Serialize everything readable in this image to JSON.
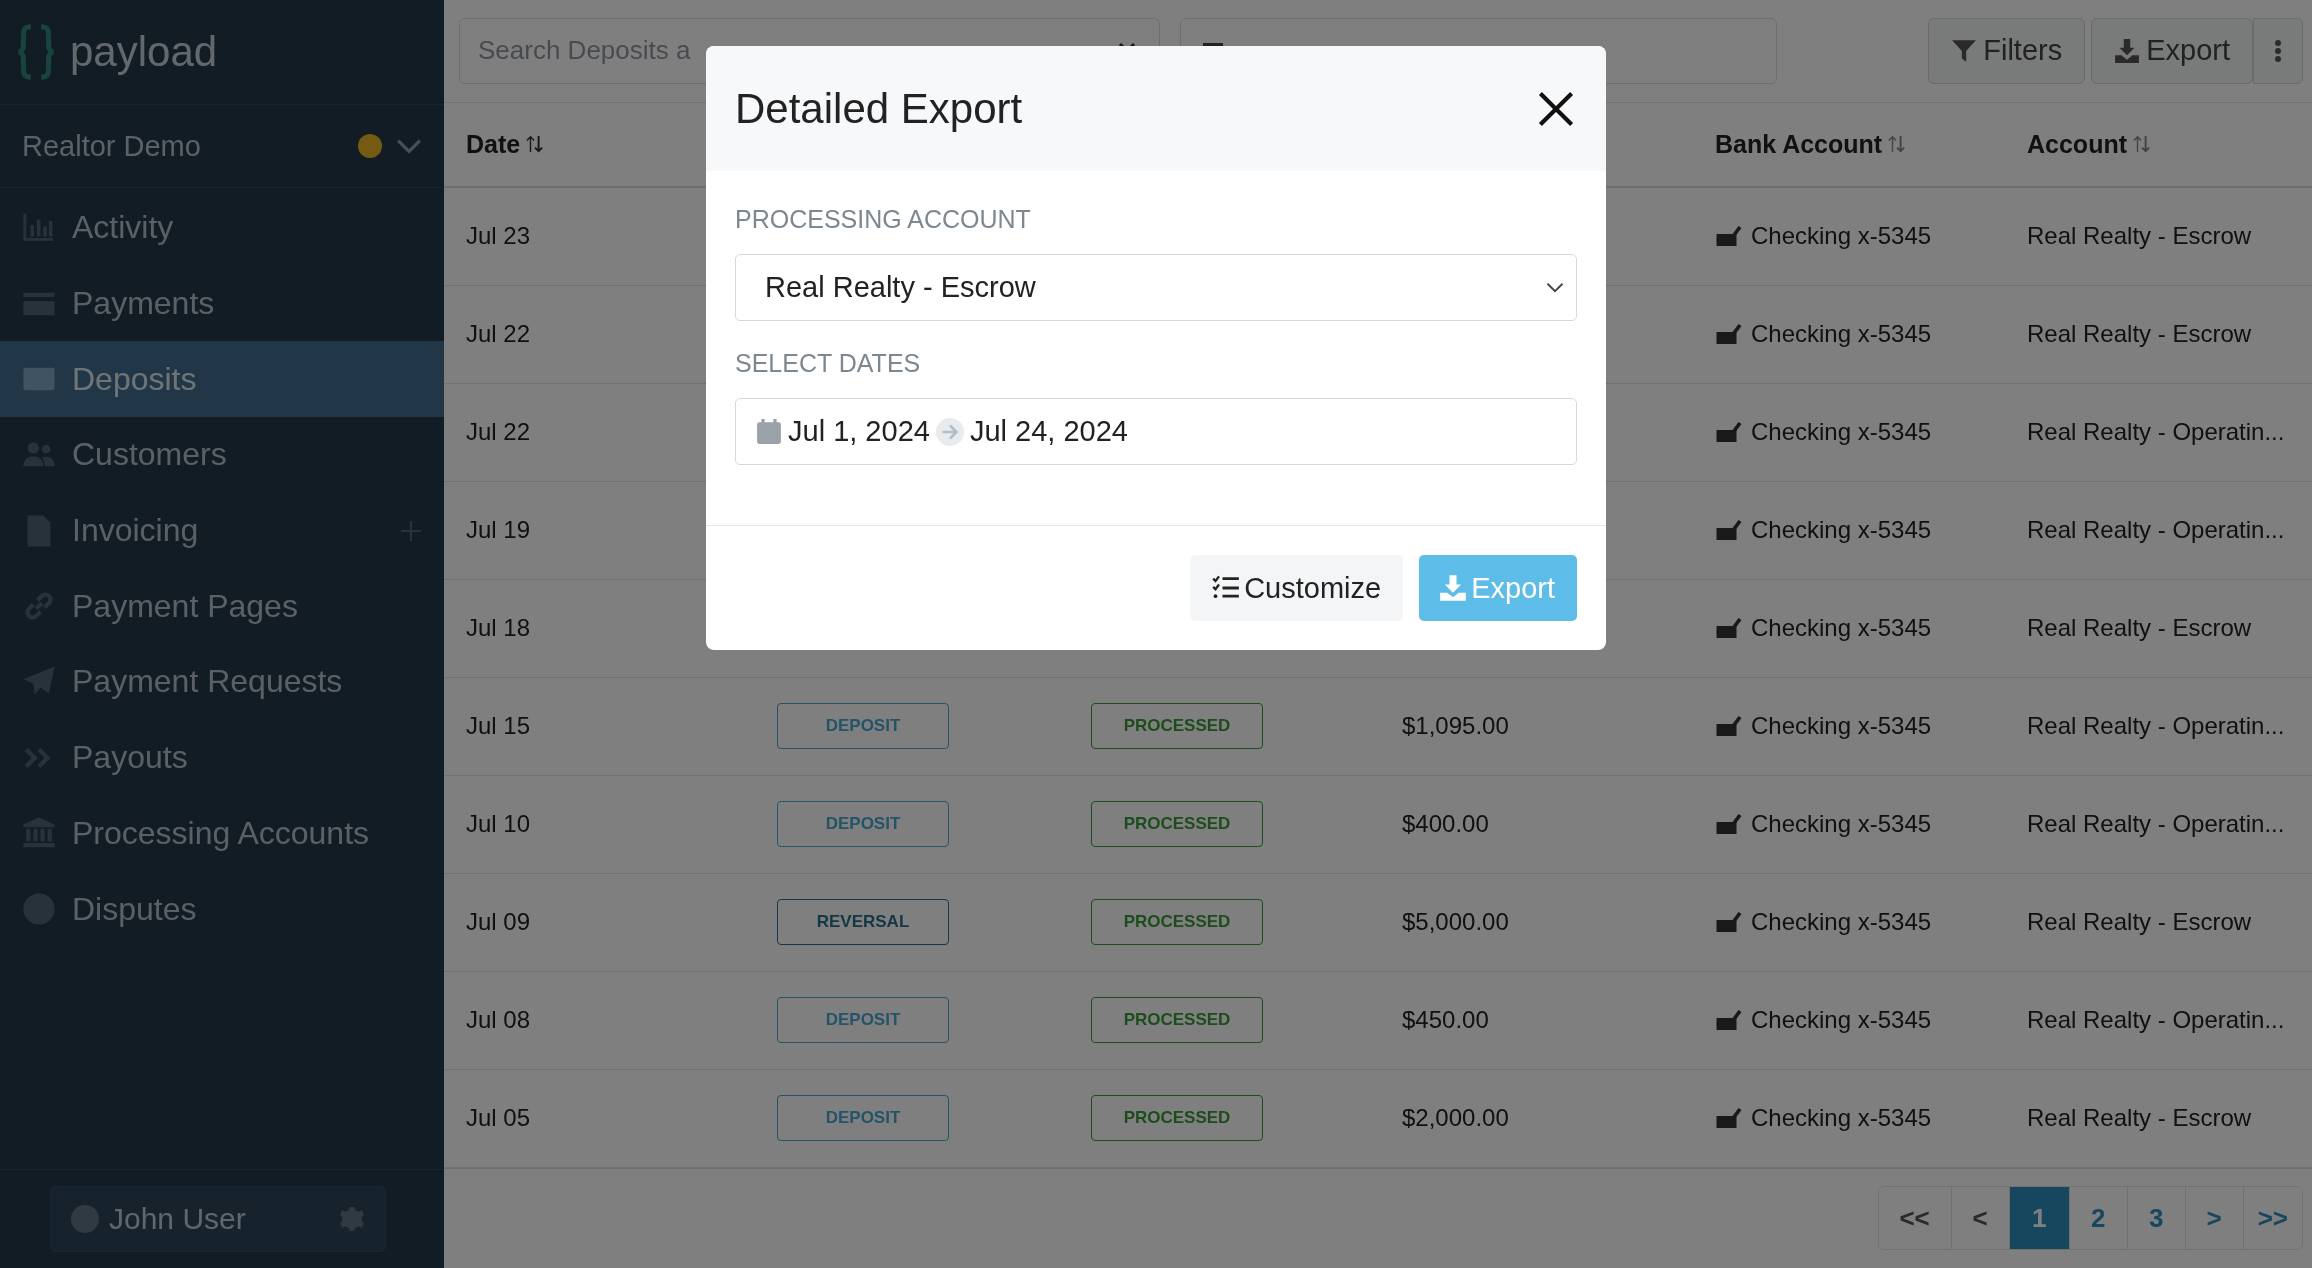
{
  "brand": {
    "name": "payload"
  },
  "sidebar": {
    "org": {
      "name": "Realtor Demo"
    },
    "items": [
      {
        "label": "Activity",
        "selected": false,
        "add_button": false
      },
      {
        "label": "Payments",
        "selected": false,
        "add_button": false
      },
      {
        "label": "Deposits",
        "selected": true,
        "add_button": false
      },
      {
        "label": "Customers",
        "selected": false,
        "add_button": false
      },
      {
        "label": "Invoicing",
        "selected": false,
        "add_button": true
      },
      {
        "label": "Payment Pages",
        "selected": false,
        "add_button": false
      },
      {
        "label": "Payment Requests",
        "selected": false,
        "add_button": false
      },
      {
        "label": "Payouts",
        "selected": false,
        "add_button": false
      },
      {
        "label": "Processing Accounts",
        "selected": false,
        "add_button": false
      },
      {
        "label": "Disputes",
        "selected": false,
        "add_button": false
      }
    ],
    "user": {
      "name": "John User"
    }
  },
  "toolbar": {
    "search": {
      "placeholder": "Search Deposits a"
    },
    "buttons": [
      {
        "label": "Filters"
      },
      {
        "label": "Export"
      }
    ]
  },
  "table": {
    "header": {
      "date": "Date",
      "bank_account": "Bank Account",
      "account": "Account"
    },
    "rows": [
      {
        "date": "Jul 23",
        "bank_account": "Checking x-5345",
        "account": "Real Realty - Escrow"
      },
      {
        "date": "Jul 22",
        "bank_account": "Checking x-5345",
        "account": "Real Realty - Escrow"
      },
      {
        "date": "Jul 22",
        "bank_account": "Checking x-5345",
        "account": "Real Realty - Operatin..."
      },
      {
        "date": "Jul 19",
        "bank_account": "Checking x-5345",
        "account": "Real Realty - Operatin..."
      },
      {
        "date": "Jul 18",
        "bank_account": "Checking x-5345",
        "account": "Real Realty - Escrow"
      },
      {
        "date": "Jul 15",
        "type": "DEPOSIT",
        "kind": "deposit",
        "status": "PROCESSED",
        "amount": "$1,095.00",
        "bank_account": "Checking x-5345",
        "account": "Real Realty - Operatin..."
      },
      {
        "date": "Jul 10",
        "type": "DEPOSIT",
        "kind": "deposit",
        "status": "PROCESSED",
        "amount": "$400.00",
        "bank_account": "Checking x-5345",
        "account": "Real Realty - Operatin..."
      },
      {
        "date": "Jul 09",
        "type": "REVERSAL",
        "kind": "reversal",
        "status": "PROCESSED",
        "amount": "$5,000.00",
        "bank_account": "Checking x-5345",
        "account": "Real Realty - Escrow"
      },
      {
        "date": "Jul 08",
        "type": "DEPOSIT",
        "kind": "deposit",
        "status": "PROCESSED",
        "amount": "$450.00",
        "bank_account": "Checking x-5345",
        "account": "Real Realty - Operatin..."
      },
      {
        "date": "Jul 05",
        "type": "DEPOSIT",
        "kind": "deposit",
        "status": "PROCESSED",
        "amount": "$2,000.00",
        "bank_account": "Checking x-5345",
        "account": "Real Realty - Escrow"
      }
    ]
  },
  "pagination": {
    "pages": [
      {
        "label": "<<",
        "selected": false,
        "disabled": true
      },
      {
        "label": "<",
        "selected": false,
        "disabled": true
      },
      {
        "label": "1",
        "selected": true,
        "disabled": false
      },
      {
        "label": "2",
        "selected": false,
        "disabled": false
      },
      {
        "label": "3",
        "selected": false,
        "disabled": false
      },
      {
        "label": ">",
        "selected": false,
        "disabled": false
      },
      {
        "label": ">>",
        "selected": false,
        "disabled": false
      }
    ]
  },
  "modal": {
    "title": "Detailed Export",
    "fields": [
      {
        "kind": "select",
        "label": "PROCESSING ACCOUNT",
        "value": "Real Realty - Escrow"
      },
      {
        "kind": "daterange",
        "label": "SELECT DATES",
        "start": "Jul 1, 2024",
        "end": "Jul 24, 2024"
      }
    ],
    "buttons": [
      {
        "kind": "secondary",
        "label": "Customize"
      },
      {
        "kind": "primary",
        "label": "Export"
      }
    ]
  }
}
